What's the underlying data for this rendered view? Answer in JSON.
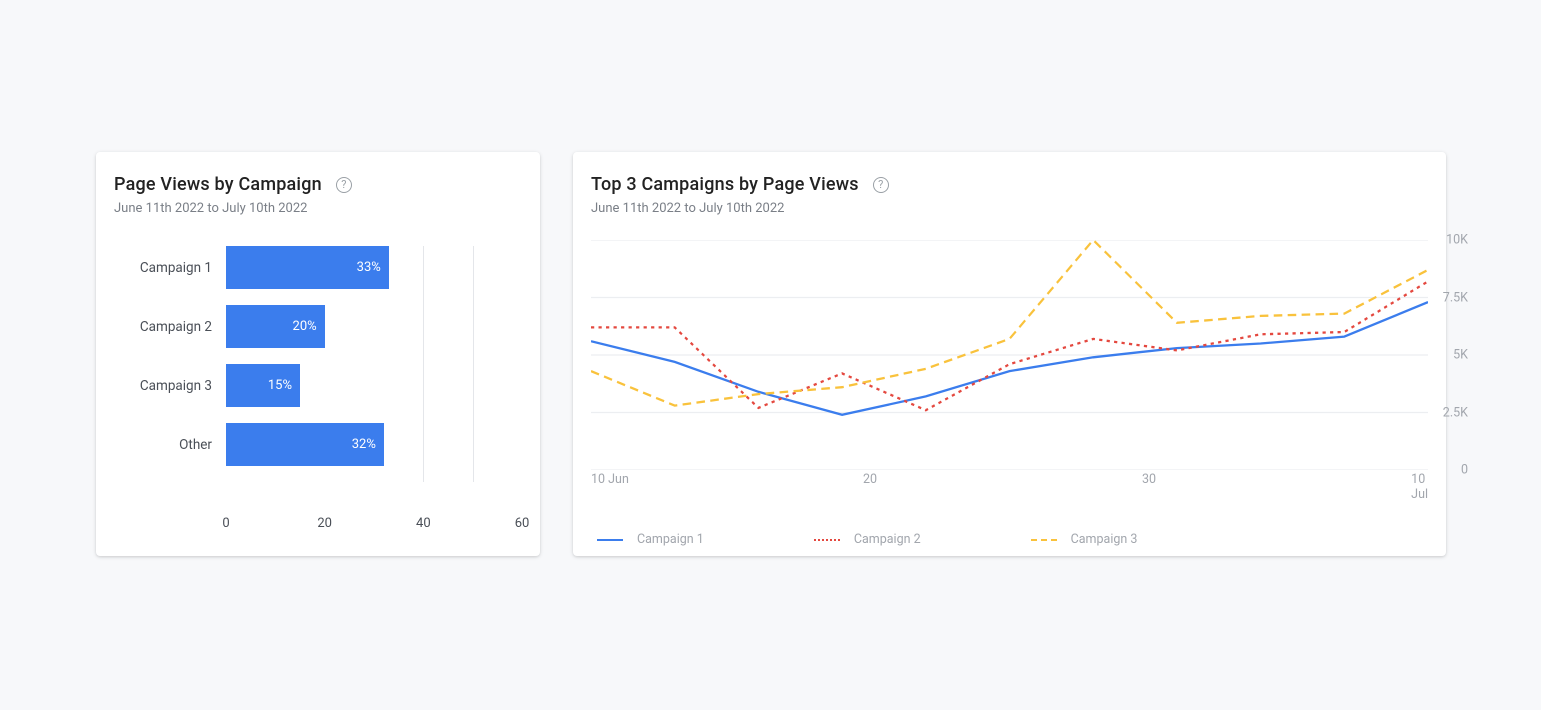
{
  "bar_card": {
    "title": "Page Views by Campaign",
    "subtitle": "June 11th 2022 to July 10th 2022",
    "help_glyph": "?"
  },
  "line_card": {
    "title": "Top 3 Campaigns by Page Views",
    "subtitle": "June 11th 2022 to July 10th 2022",
    "help_glyph": "?"
  },
  "colors": {
    "bar": "#3b7ded",
    "series1": "#3b7ded",
    "series2": "#e4483f",
    "series3": "#f9c23c"
  },
  "chart_data": [
    {
      "type": "bar",
      "orientation": "horizontal",
      "title": "Page Views by Campaign",
      "xlabel": "",
      "ylabel": "",
      "xlim": [
        0,
        60
      ],
      "xticks": [
        0,
        20,
        40,
        60
      ],
      "categories": [
        "Campaign 1",
        "Campaign 2",
        "Campaign 3",
        "Other"
      ],
      "values": [
        33,
        20,
        15,
        32
      ],
      "value_suffix": "%",
      "grid_vlines_at": [
        40,
        50
      ]
    },
    {
      "type": "line",
      "title": "Top 3 Campaigns by Page Views",
      "xlabel": "",
      "ylabel": "",
      "ylim": [
        0,
        10000
      ],
      "yticks": [
        0,
        2500,
        5000,
        7500,
        10000
      ],
      "ytick_labels": [
        "0",
        "2.5K",
        "5K",
        "7.5K",
        "10K"
      ],
      "x": [
        10,
        13,
        16,
        19,
        22,
        25,
        28,
        31,
        34,
        37,
        40
      ],
      "xtick_values": [
        10,
        20,
        30,
        40
      ],
      "xtick_labels": [
        "10 Jun",
        "20",
        "30",
        "10 Jul"
      ],
      "series": [
        {
          "name": "Campaign 1",
          "style": "solid",
          "color": "#3b7ded",
          "values": [
            5600,
            4700,
            3400,
            2400,
            3200,
            4300,
            4900,
            5300,
            5500,
            5800,
            7300
          ]
        },
        {
          "name": "Campaign 2",
          "style": "dotted",
          "color": "#e4483f",
          "values": [
            6200,
            6200,
            2700,
            4200,
            2600,
            4600,
            5700,
            5200,
            5900,
            6000,
            8200
          ]
        },
        {
          "name": "Campaign 3",
          "style": "dashed",
          "color": "#f9c23c",
          "values": [
            4300,
            2800,
            3300,
            3600,
            4400,
            5700,
            10000,
            6400,
            6700,
            6800,
            8700
          ]
        }
      ],
      "legend": [
        "Campaign 1",
        "Campaign 2",
        "Campaign 3"
      ]
    }
  ]
}
